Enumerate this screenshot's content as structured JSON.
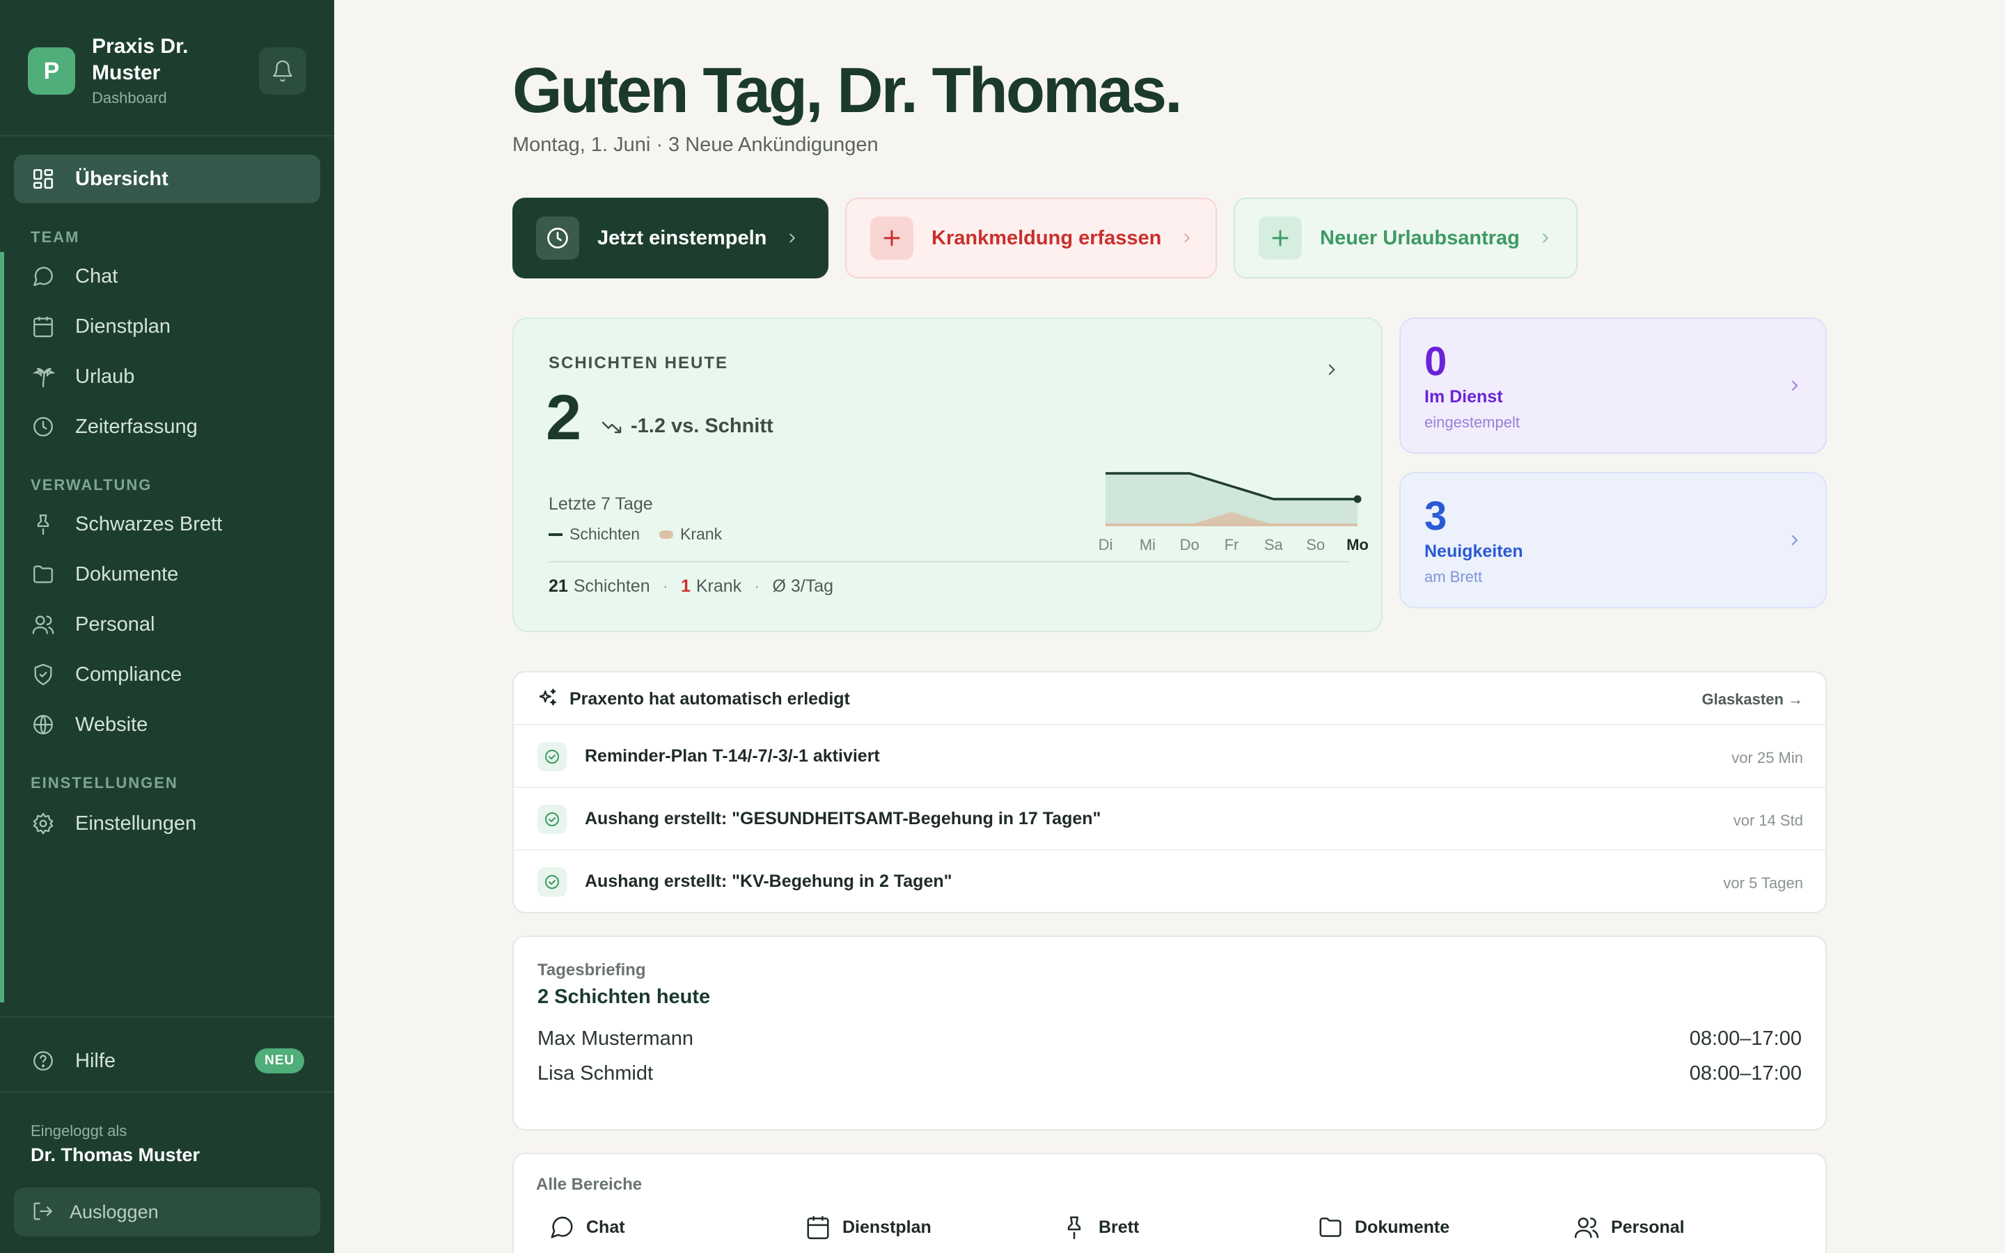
{
  "sidebar": {
    "logo_letter": "P",
    "practice_name": "Praxis Dr. Muster",
    "practice_sub": "Dashboard",
    "active_item": "Übersicht",
    "sections": {
      "team": "TEAM",
      "verwaltung": "VERWALTUNG",
      "einstellungen": "EINSTELLUNGEN"
    },
    "team_items": [
      "Chat",
      "Dienstplan",
      "Urlaub",
      "Zeiterfassung"
    ],
    "verwaltung_items": [
      "Schwarzes Brett",
      "Dokumente",
      "Personal",
      "Compliance",
      "Website"
    ],
    "settings_item": "Einstellungen",
    "help_label": "Hilfe",
    "help_badge": "NEU",
    "logged_in_label": "Eingeloggt als",
    "logged_in_name": "Dr. Thomas Muster",
    "logout_label": "Ausloggen"
  },
  "header": {
    "greeting": "Guten Tag, Dr. Thomas.",
    "subline": "Montag, 1. Juni · 3 Neue Ankündigungen"
  },
  "quick_actions": {
    "clock_in": "Jetzt einstempeln",
    "sick_note": "Krankmeldung erfassen",
    "vacation": "Neuer Urlaubsantrag"
  },
  "shifts_card": {
    "title": "SCHICHTEN HEUTE",
    "count": "2",
    "trend": "-1.2 vs. Schnitt",
    "period": "Letzte 7 Tage",
    "legend_shifts": "Schichten",
    "legend_sick": "Krank",
    "footer": {
      "shifts_num": "21",
      "shifts_label": "Schichten",
      "sick_num": "1",
      "sick_label": "Krank",
      "avg": "Ø 3/Tag"
    }
  },
  "chart_data": {
    "type": "area",
    "x": [
      "Di",
      "Mi",
      "Do",
      "Fr",
      "Sa",
      "So",
      "Mo"
    ],
    "highlight_x": "Mo",
    "series": [
      {
        "name": "Schichten",
        "values": [
          4,
          4,
          4,
          3,
          2,
          2,
          2
        ],
        "color": "#1f3d2f"
      },
      {
        "name": "Krank",
        "values": [
          0,
          0,
          0,
          1,
          0,
          0,
          0
        ],
        "color": "#dcc0a8"
      }
    ],
    "ylim": [
      0,
      4
    ],
    "grid": false
  },
  "stats": {
    "on_duty": {
      "value": "0",
      "label": "Im Dienst",
      "sub": "eingestempelt"
    },
    "news": {
      "value": "3",
      "label": "Neuigkeiten",
      "sub": "am Brett"
    }
  },
  "automation": {
    "title": "Praxento hat automatisch erledigt",
    "link": "Glaskasten →",
    "rows": [
      {
        "text": "Reminder-Plan T-14/-7/-3/-1 aktiviert",
        "time": "vor 25 Min"
      },
      {
        "text": "Aushang erstellt: \"GESUNDHEITSAMT-Begehung in 17 Tagen\"",
        "time": "vor 14 Std"
      },
      {
        "text": "Aushang erstellt: \"KV-Begehung in 2 Tagen\"",
        "time": "vor 5 Tagen"
      }
    ]
  },
  "briefing": {
    "label": "Tagesbriefing",
    "title": "2 Schichten heute",
    "rows": [
      {
        "name": "Max Mustermann",
        "time": "08:00–17:00"
      },
      {
        "name": "Lisa Schmidt",
        "time": "08:00–17:00"
      }
    ]
  },
  "areas": {
    "label": "Alle Bereiche",
    "items": [
      "Chat",
      "Dienstplan",
      "Brett",
      "Dokumente",
      "Personal"
    ]
  },
  "colors": {
    "sidebar_bg": "#1d3e2f",
    "accent_green": "#4fae7a",
    "sick_red": "#c9302c",
    "purple": "#6b23d6",
    "blue": "#2a5ad6"
  }
}
